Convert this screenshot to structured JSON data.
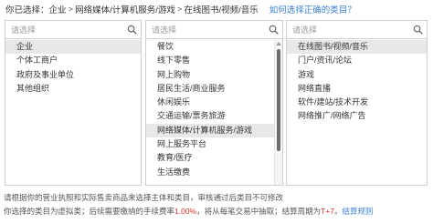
{
  "breadcrumb": {
    "prefix": "你已选择：",
    "path": [
      "企业",
      "网络媒体/计算机服务/游戏",
      "在线图书/视频/音乐"
    ],
    "separator": ">",
    "help_link": "如何选择正确的类目？"
  },
  "panels": {
    "level1": {
      "search_placeholder": "请选择",
      "items": [
        "企业",
        "个体工商户",
        "政府及事业单位",
        "其他组织"
      ],
      "selected_index": 0
    },
    "level2": {
      "search_placeholder": "请选择",
      "items": [
        "餐饮",
        "线下零售",
        "网上购物",
        "居民生活/商业服务",
        "休闲娱乐",
        "交通运输/票务旅游",
        "网络媒体/计算机服务/游戏",
        "网上服务平台",
        "教育/医疗",
        "生活缴费"
      ],
      "selected_index": 6
    },
    "level3": {
      "search_placeholder": "请选择",
      "items": [
        "在线图书/视频/音乐",
        "门户/资讯/论坛",
        "游戏",
        "网络直播",
        "软件/建站/技术开发",
        "网络推广/网络广告"
      ],
      "selected_index": 0
    }
  },
  "notes": {
    "line1": "请根据你的营业执照和实际售卖商品来选择主体和类目，审核通过后类目不可修改",
    "line2_a": "你选择的类目为虚拟类；后续需要缴纳的手续费率",
    "rate": "1.00%",
    "line2_b": "，将从每笔交易中抽取；结算周期为",
    "period": "T+7",
    "line2_c": "。",
    "rules_link": "结算规则"
  },
  "colors": {
    "link": "#3b7fd1",
    "highlight": "#e0322c",
    "selected_bg": "#e8e8e8"
  },
  "icons": {
    "search": "search-icon",
    "scroll_up": "scroll-up-arrow-icon"
  }
}
